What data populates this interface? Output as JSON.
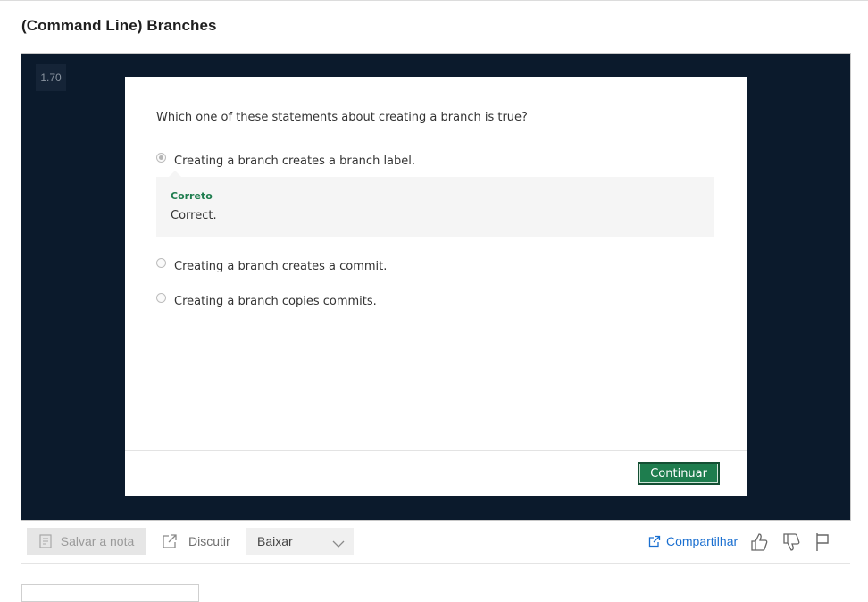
{
  "page": {
    "title": "(Command Line) Branches"
  },
  "player": {
    "speed": "1.70"
  },
  "quiz": {
    "question": "Which one of these statements about creating a branch is true?",
    "options": [
      {
        "label": "Creating a branch creates a branch label.",
        "selected": true
      },
      {
        "label": "Creating a branch creates a commit.",
        "selected": false
      },
      {
        "label": "Creating a branch copies commits.",
        "selected": false
      }
    ],
    "feedback": {
      "title": "Correto",
      "text": "Correct."
    },
    "continue_label": "Continuar"
  },
  "toolbar": {
    "save_note_label": "Salvar a nota",
    "discuss_label": "Discutir",
    "download_label": "Baixar",
    "share_label": "Compartilhar"
  },
  "colors": {
    "accent_green": "#1e7d4e",
    "link_blue": "#1a6fd0",
    "player_bg": "#0b1a2c"
  }
}
